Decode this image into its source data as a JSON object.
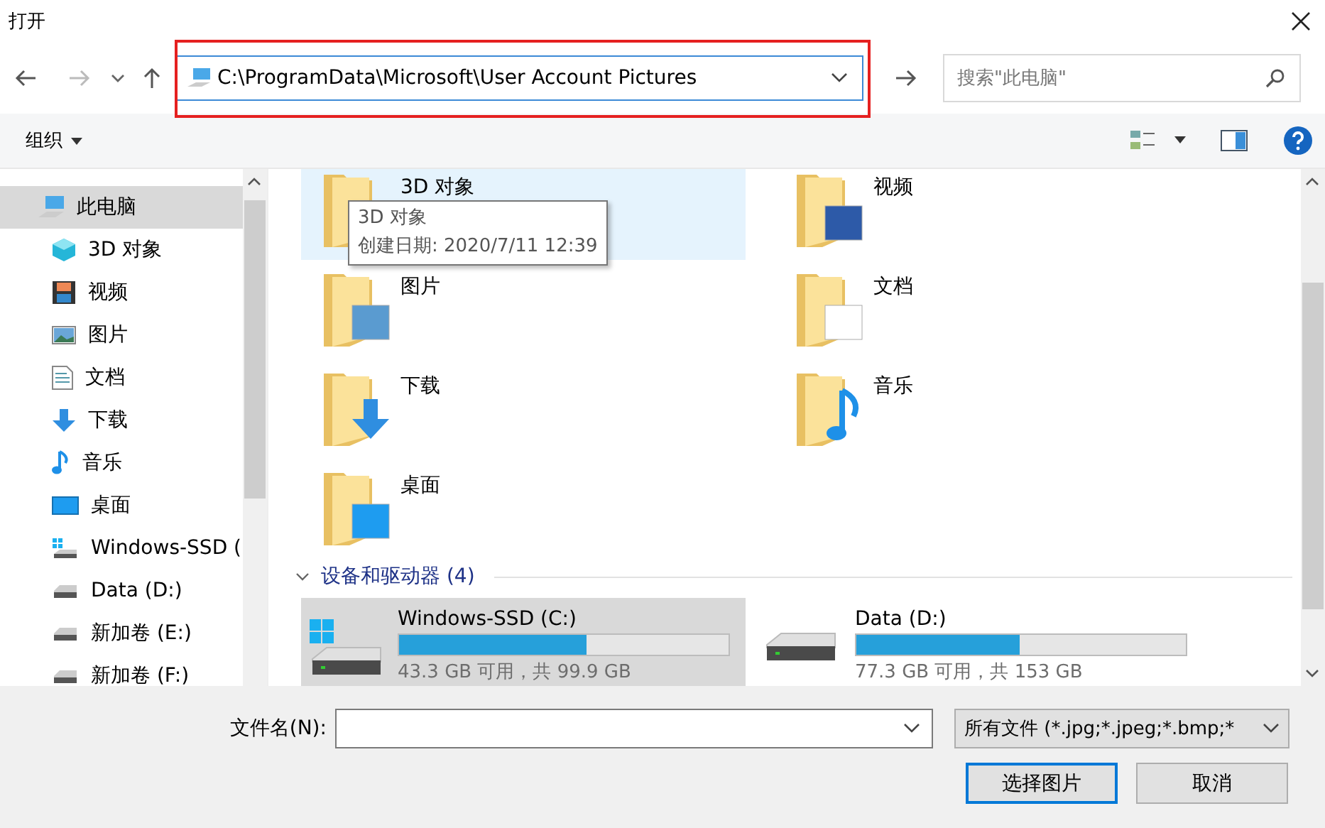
{
  "window": {
    "title": "打开"
  },
  "address": {
    "path": "C:\\ProgramData\\Microsoft\\User Account Pictures"
  },
  "search": {
    "placeholder": "搜索\"此电脑\""
  },
  "toolbar": {
    "organize": "组织"
  },
  "sidebar": {
    "items": [
      {
        "label": "此电脑",
        "kind": "pc",
        "selected": true,
        "children": [
          {
            "label": "3D 对象",
            "kind": "objects",
            "selected": false
          },
          {
            "label": "视频",
            "kind": "video",
            "selected": false
          },
          {
            "label": "图片",
            "kind": "picture",
            "selected": false
          },
          {
            "label": "文档",
            "kind": "document",
            "selected": false
          },
          {
            "label": "下载",
            "kind": "download",
            "selected": false
          },
          {
            "label": "音乐",
            "kind": "music",
            "selected": false
          },
          {
            "label": "桌面",
            "kind": "desktop",
            "selected": false
          },
          {
            "label": "Windows-SSD (",
            "kind": "system-drive",
            "selected": false
          },
          {
            "label": "Data (D:)",
            "kind": "drive",
            "selected": false
          },
          {
            "label": "新加卷 (E:)",
            "kind": "drive",
            "selected": false
          },
          {
            "label": "新加卷 (F:)",
            "kind": "drive",
            "selected": false
          }
        ]
      }
    ]
  },
  "folders": [
    {
      "label": "3D 对象",
      "kind": "objects",
      "selected": true
    },
    {
      "label": "视频",
      "kind": "video",
      "selected": false
    },
    {
      "label": "图片",
      "kind": "picture",
      "selected": false
    },
    {
      "label": "文档",
      "kind": "document",
      "selected": false
    },
    {
      "label": "下载",
      "kind": "download",
      "selected": false
    },
    {
      "label": "音乐",
      "kind": "music",
      "selected": false
    },
    {
      "label": "桌面",
      "kind": "desktop",
      "selected": false
    }
  ],
  "tooltip": {
    "lines": [
      "3D 对象",
      "创建日期: 2020/7/11 12:39"
    ]
  },
  "drives_group": {
    "title": "设备和驱动器 (4)",
    "expanded": true
  },
  "drives": [
    {
      "name": "Windows-SSD (C:)",
      "kind": "system-drive",
      "level": 0.567,
      "space": "43.3 GB 可用，共 99.9 GB",
      "selected": true
    },
    {
      "name": "Data (D:)",
      "kind": "drive",
      "level": 0.495,
      "space": "77.3 GB 可用，共 153 GB",
      "selected": false
    }
  ],
  "footer": {
    "filename_label": "文件名(N):",
    "filter": "所有文件 (*.jpg;*.jpeg;*.bmp;*",
    "buttons": [
      "选择图片",
      "取消"
    ]
  }
}
